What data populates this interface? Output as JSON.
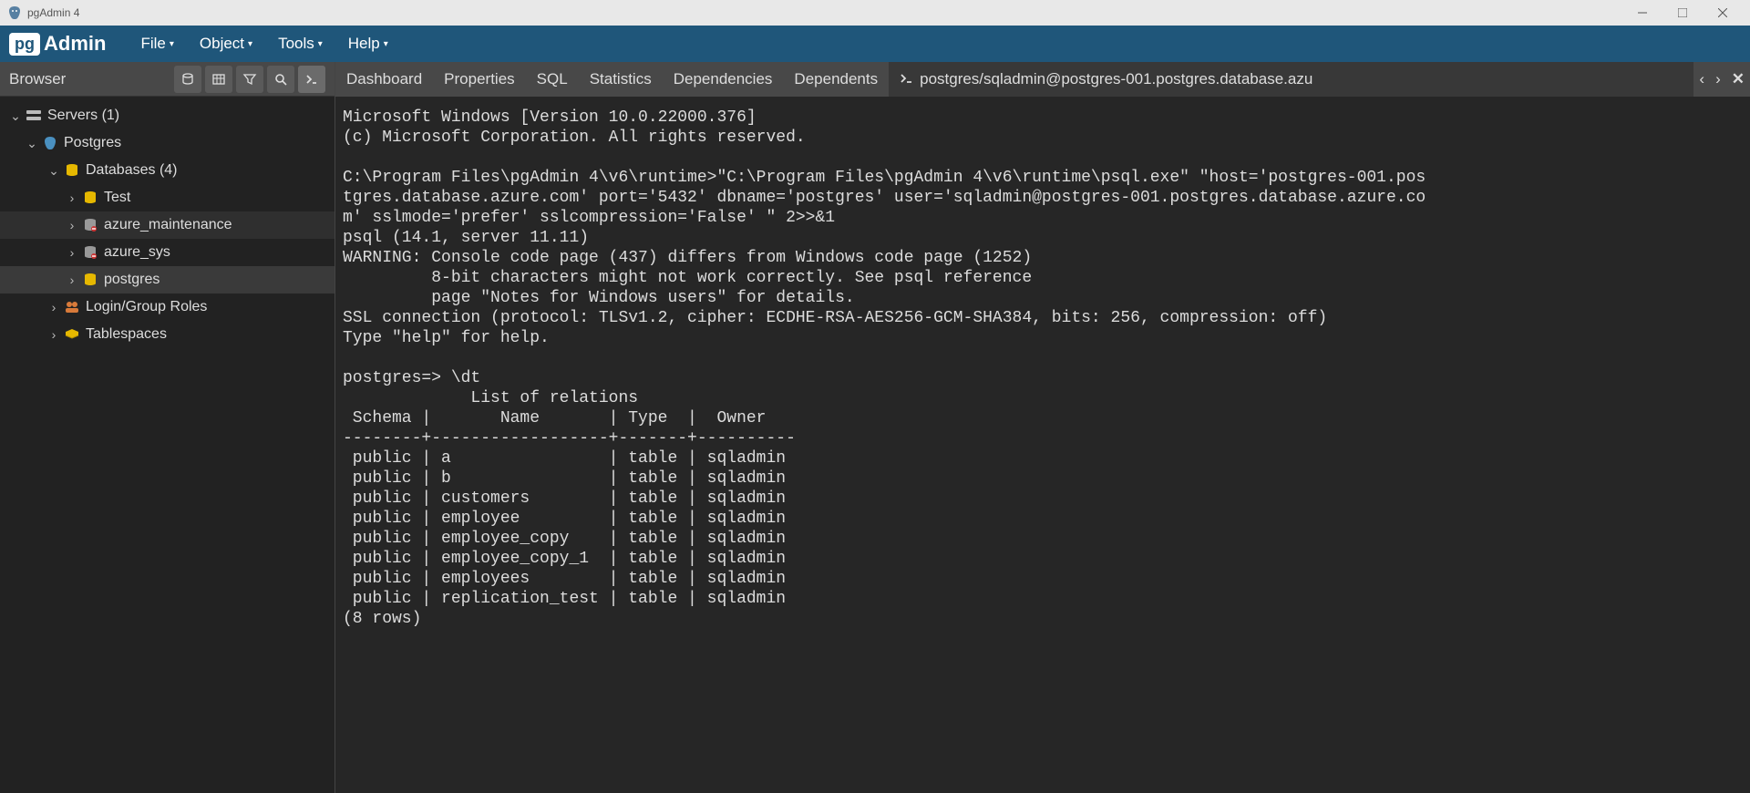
{
  "window": {
    "title": "pgAdmin 4"
  },
  "menu": {
    "file": "File",
    "object": "Object",
    "tools": "Tools",
    "help": "Help"
  },
  "browser": {
    "title": "Browser",
    "tree": {
      "servers": "Servers (1)",
      "postgres_group": "Postgres",
      "databases": "Databases (4)",
      "db_test": "Test",
      "db_azure_maint": "azure_maintenance",
      "db_azure_sys": "azure_sys",
      "db_postgres": "postgres",
      "login_roles": "Login/Group Roles",
      "tablespaces": "Tablespaces"
    }
  },
  "tabs": {
    "dashboard": "Dashboard",
    "properties": "Properties",
    "sql": "SQL",
    "statistics": "Statistics",
    "dependencies": "Dependencies",
    "dependents": "Dependents",
    "psql_tab": "postgres/sqladmin@postgres-001.postgres.database.azu"
  },
  "terminal_text": "Microsoft Windows [Version 10.0.22000.376]\n(c) Microsoft Corporation. All rights reserved.\n\nC:\\Program Files\\pgAdmin 4\\v6\\runtime>\"C:\\Program Files\\pgAdmin 4\\v6\\runtime\\psql.exe\" \"host='postgres-001.pos\ntgres.database.azure.com' port='5432' dbname='postgres' user='sqladmin@postgres-001.postgres.database.azure.co\nm' sslmode='prefer' sslcompression='False' \" 2>>&1\npsql (14.1, server 11.11)\nWARNING: Console code page (437) differs from Windows code page (1252)\n         8-bit characters might not work correctly. See psql reference\n         page \"Notes for Windows users\" for details.\nSSL connection (protocol: TLSv1.2, cipher: ECDHE-RSA-AES256-GCM-SHA384, bits: 256, compression: off)\nType \"help\" for help.\n\npostgres=> \\dt\n             List of relations\n Schema |       Name       | Type  |  Owner\n--------+------------------+-------+----------\n public | a                | table | sqladmin\n public | b                | table | sqladmin\n public | customers        | table | sqladmin\n public | employee         | table | sqladmin\n public | employee_copy    | table | sqladmin\n public | employee_copy_1  | table | sqladmin\n public | employees        | table | sqladmin\n public | replication_test | table | sqladmin\n(8 rows)\n"
}
